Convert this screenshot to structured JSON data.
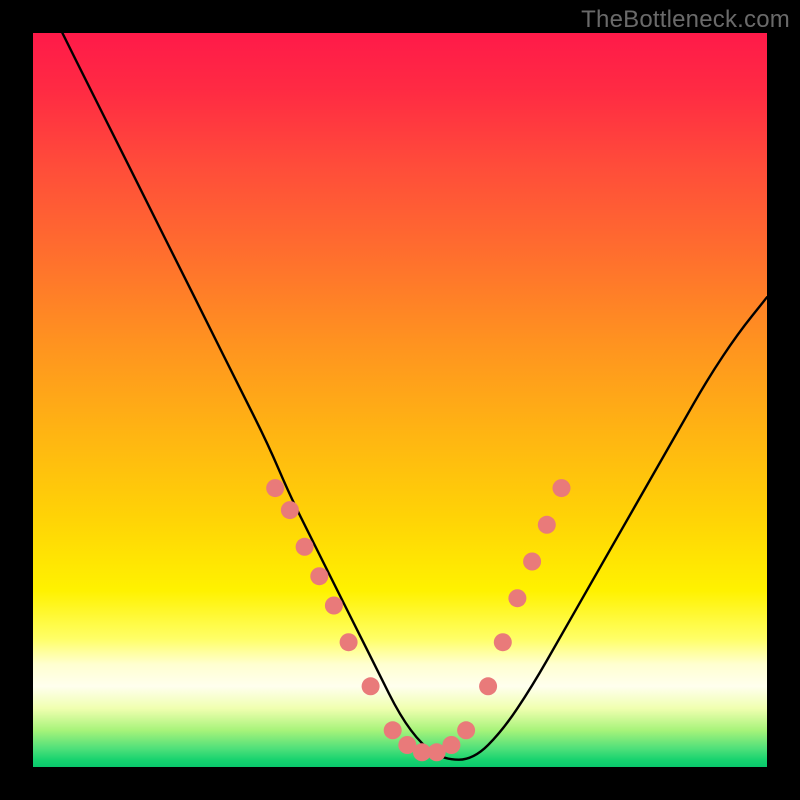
{
  "watermark": "TheBottleneck.com",
  "chart_data": {
    "type": "line",
    "title": "",
    "xlabel": "",
    "ylabel": "",
    "xlim": [
      0,
      100
    ],
    "ylim": [
      0,
      100
    ],
    "grid": false,
    "legend": false,
    "series": [
      {
        "name": "curve",
        "x": [
          4,
          8,
          12,
          16,
          20,
          24,
          28,
          32,
          35,
          38,
          41,
          44,
          47,
          50,
          53,
          56,
          60,
          64,
          68,
          72,
          76,
          80,
          84,
          88,
          92,
          96,
          100
        ],
        "values": [
          100,
          92,
          84,
          76,
          68,
          60,
          52,
          44,
          37,
          31,
          25,
          19,
          13,
          7,
          3,
          1,
          1,
          5,
          11,
          18,
          25,
          32,
          39,
          46,
          53,
          59,
          64
        ]
      }
    ],
    "markers": {
      "name": "dots",
      "color": "#e97a7a",
      "points": [
        {
          "x": 33,
          "y": 38
        },
        {
          "x": 35,
          "y": 35
        },
        {
          "x": 37,
          "y": 30
        },
        {
          "x": 39,
          "y": 26
        },
        {
          "x": 41,
          "y": 22
        },
        {
          "x": 43,
          "y": 17
        },
        {
          "x": 46,
          "y": 11
        },
        {
          "x": 49,
          "y": 5
        },
        {
          "x": 51,
          "y": 3
        },
        {
          "x": 53,
          "y": 2
        },
        {
          "x": 55,
          "y": 2
        },
        {
          "x": 57,
          "y": 3
        },
        {
          "x": 59,
          "y": 5
        },
        {
          "x": 62,
          "y": 11
        },
        {
          "x": 64,
          "y": 17
        },
        {
          "x": 66,
          "y": 23
        },
        {
          "x": 68,
          "y": 28
        },
        {
          "x": 70,
          "y": 33
        },
        {
          "x": 72,
          "y": 38
        }
      ]
    }
  }
}
